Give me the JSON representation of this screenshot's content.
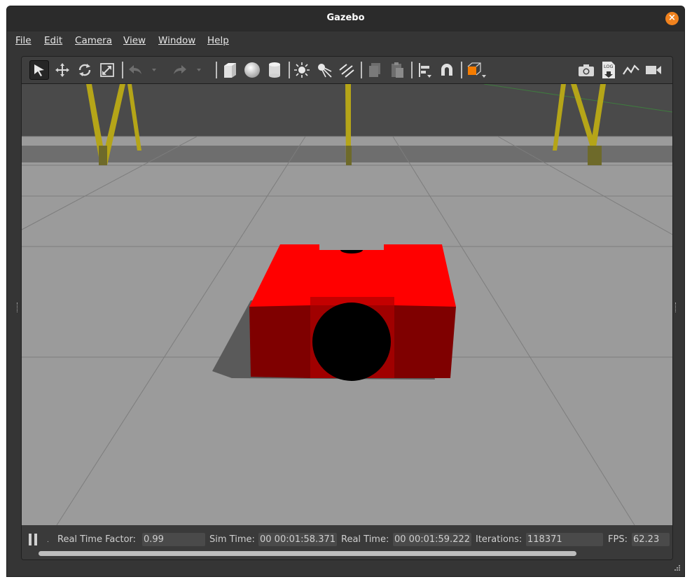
{
  "window": {
    "title": "Gazebo"
  },
  "menu": [
    "File",
    "Edit",
    "Camera",
    "View",
    "Window",
    "Help"
  ],
  "toolbar": {
    "tools": [
      "select-arrow-icon",
      "translate-icon",
      "rotate-icon",
      "scale-icon",
      "undo-icon",
      "undo-dropdown-icon",
      "redo-icon",
      "redo-dropdown-icon",
      "box-icon",
      "sphere-icon",
      "cylinder-icon",
      "point-light-icon",
      "spot-light-icon",
      "directional-light-icon",
      "copy-icon",
      "paste-icon",
      "align-icon",
      "snap-magnet-icon",
      "view-angle-icon",
      "screenshot-icon",
      "log-icon",
      "plot-icon",
      "video-record-icon"
    ]
  },
  "status": {
    "rtf_label": "Real Time Factor:",
    "rtf_value": "0.99",
    "sim_label": "Sim Time:",
    "sim_value": "00 00:01:58.371",
    "real_label": "Real Time:",
    "real_value": "00 00:01:59.222",
    "iter_label": "Iterations:",
    "iter_value": "118371",
    "fps_label": "FPS:",
    "fps_value": "62.23"
  },
  "colors": {
    "robot_body": "#ff0000",
    "robot_shade": "#7f0000",
    "ground": "#999999",
    "sky": "#4a4a4a",
    "pillar": "#b5a518",
    "close_button": "#f0821e",
    "view_angle_accent": "#f57c00"
  }
}
